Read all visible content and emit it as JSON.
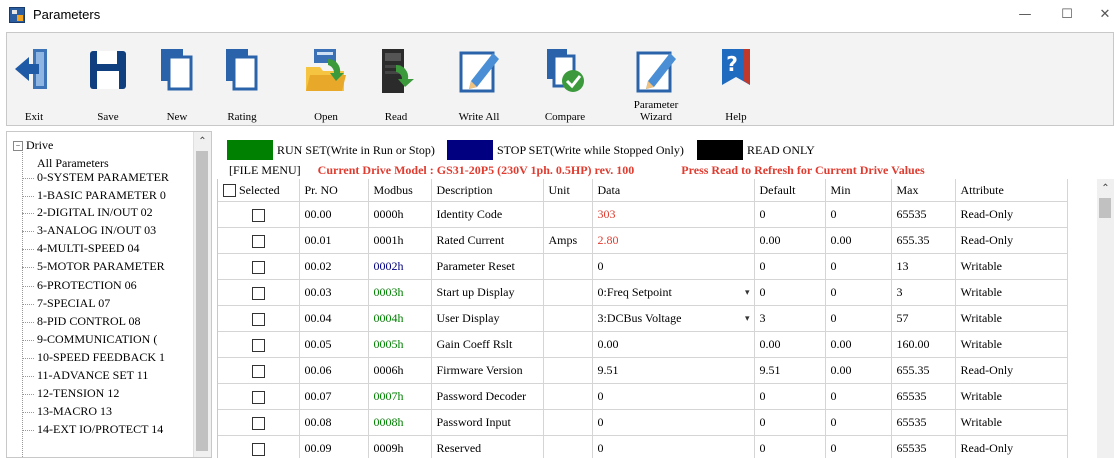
{
  "window": {
    "title": "Parameters",
    "minimize": "—",
    "maximize": "☐",
    "close": "✕"
  },
  "toolbar": {
    "buttons": [
      {
        "label": "Exit",
        "icon": "exit-icon"
      },
      {
        "label": "Save",
        "icon": "save-icon"
      },
      {
        "label": "New",
        "icon": "new-file-icon"
      },
      {
        "label": "Rating",
        "icon": "rating-icon"
      },
      {
        "label": "Open",
        "icon": "open-folder-icon"
      },
      {
        "label": "Read",
        "icon": "read-drive-icon"
      },
      {
        "label": "Write All",
        "icon": "write-all-icon"
      },
      {
        "label": "Compare",
        "icon": "compare-icon"
      },
      {
        "label": "Parameter Wizard",
        "icon": "wizard-icon"
      },
      {
        "label": "Help",
        "icon": "help-icon"
      }
    ]
  },
  "tree": {
    "root": "Drive",
    "items": [
      "All Parameters",
      "0-SYSTEM PARAMETER",
      "1-BASIC PARAMETER 0",
      "2-DIGITAL IN/OUT 02",
      "3-ANALOG IN/OUT 03",
      "4-MULTI-SPEED 04",
      "5-MOTOR PARAMETER",
      "6-PROTECTION 06",
      "7-SPECIAL 07",
      "8-PID CONTROL 08",
      "9-COMMUNICATION (",
      "10-SPEED FEEDBACK 1",
      "11-ADVANCE SET 11",
      "12-TENSION 12",
      "13-MACRO 13",
      "14-EXT IO/PROTECT 14"
    ]
  },
  "legend": {
    "run_set": "RUN SET(Write in Run or Stop)",
    "stop_set": "STOP SET(Write while Stopped Only)",
    "read_only": "READ ONLY",
    "colors": {
      "run": "#008000",
      "stop": "#000080",
      "read": "#000000"
    }
  },
  "status": {
    "file_menu": "[FILE MENU]",
    "drive_model": "Current Drive Model : GS31-20P5 (230V 1ph. 0.5HP) rev. 100",
    "hint": "Press Read to Refresh for Current Drive Values"
  },
  "table": {
    "columns": [
      "Selected",
      "Pr. NO",
      "Modbus",
      "Description",
      "Unit",
      "Data",
      "Default",
      "Min",
      "Max",
      "Attribute"
    ],
    "rows": [
      {
        "pr": "00.00",
        "modbus": "0000h",
        "modbus_color": "#000000",
        "desc": "Identity Code",
        "unit": "",
        "data": "303",
        "data_color": "#e03b2f",
        "dropdown": false,
        "def": "0",
        "min": "0",
        "max": "65535",
        "attr": "Read-Only"
      },
      {
        "pr": "00.01",
        "modbus": "0001h",
        "modbus_color": "#000000",
        "desc": "Rated Current",
        "unit": "Amps",
        "data": "2.80",
        "data_color": "#e03b2f",
        "dropdown": false,
        "def": "0.00",
        "min": "0.00",
        "max": "655.35",
        "attr": "Read-Only"
      },
      {
        "pr": "00.02",
        "modbus": "0002h",
        "modbus_color": "#000080",
        "desc": "Parameter Reset",
        "unit": "",
        "data": "0",
        "data_color": "#000000",
        "dropdown": false,
        "def": "0",
        "min": "0",
        "max": "13",
        "attr": "Writable"
      },
      {
        "pr": "00.03",
        "modbus": "0003h",
        "modbus_color": "#008000",
        "desc": "Start up Display",
        "unit": "",
        "data": "0:Freq Setpoint",
        "data_color": "#000000",
        "dropdown": true,
        "def": "0",
        "min": "0",
        "max": "3",
        "attr": "Writable"
      },
      {
        "pr": "00.04",
        "modbus": "0004h",
        "modbus_color": "#008000",
        "desc": "User Display",
        "unit": "",
        "data": "3:DCBus Voltage",
        "data_color": "#000000",
        "dropdown": true,
        "def": "3",
        "min": "0",
        "max": "57",
        "attr": "Writable"
      },
      {
        "pr": "00.05",
        "modbus": "0005h",
        "modbus_color": "#008000",
        "desc": "Gain Coeff Rslt",
        "unit": "",
        "data": "0.00",
        "data_color": "#000000",
        "dropdown": false,
        "def": "0.00",
        "min": "0.00",
        "max": "160.00",
        "attr": "Writable"
      },
      {
        "pr": "00.06",
        "modbus": "0006h",
        "modbus_color": "#000000",
        "desc": "Firmware Version",
        "unit": "",
        "data": "9.51",
        "data_color": "#000000",
        "dropdown": false,
        "def": "9.51",
        "min": "0.00",
        "max": "655.35",
        "attr": "Read-Only"
      },
      {
        "pr": "00.07",
        "modbus": "0007h",
        "modbus_color": "#008000",
        "desc": "Password Decoder",
        "unit": "",
        "data": "0",
        "data_color": "#000000",
        "dropdown": false,
        "def": "0",
        "min": "0",
        "max": "65535",
        "attr": "Writable"
      },
      {
        "pr": "00.08",
        "modbus": "0008h",
        "modbus_color": "#008000",
        "desc": "Password Input",
        "unit": "",
        "data": "0",
        "data_color": "#000000",
        "dropdown": false,
        "def": "0",
        "min": "0",
        "max": "65535",
        "attr": "Writable"
      },
      {
        "pr": "00.09",
        "modbus": "0009h",
        "modbus_color": "#000000",
        "desc": "Reserved",
        "unit": "",
        "data": "0",
        "data_color": "#000000",
        "dropdown": false,
        "def": "0",
        "min": "0",
        "max": "65535",
        "attr": "Read-Only"
      }
    ]
  }
}
